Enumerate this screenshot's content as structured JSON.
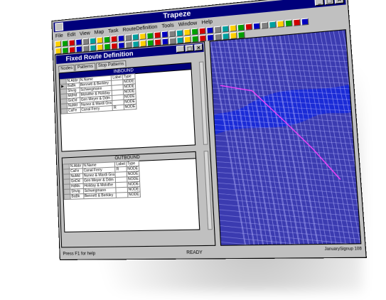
{
  "window": {
    "title": "Trapeze"
  },
  "menus": [
    "File",
    "Edit",
    "View",
    "Map",
    "Task",
    "RouteDefinition",
    "Tools",
    "Window",
    "Help"
  ],
  "child": {
    "title": "Fixed Route Definition",
    "tabs": [
      "Nodes",
      "Patterns",
      "Stop Patterns"
    ]
  },
  "inbound": {
    "header": "INBOUND",
    "columns": [
      "N.Abbr",
      "N.Name",
      "Label",
      "Type"
    ],
    "rows": [
      [
        "BaBk",
        "Bennett & Berkley",
        "",
        "NODE"
      ],
      [
        "Shvig",
        "Schwegmann",
        "",
        "NODE"
      ],
      [
        "MdHd",
        "Molvithe & Holiday",
        "",
        "NODE"
      ],
      [
        "GnDd",
        "Gen Meyer & Ddm",
        "",
        "NODE"
      ],
      [
        "NuMd",
        "Nunez & Mardi Gra",
        "",
        "NODE"
      ],
      [
        "CaFe",
        "Canal Ferry",
        "R",
        "NODE"
      ]
    ]
  },
  "outbound": {
    "header": "OUTBOUND",
    "columns": [
      "N.Abbr",
      "N.Name",
      "Label",
      "Type"
    ],
    "rows": [
      [
        "CaFe",
        "Canal Ferry",
        "R",
        "NODE"
      ],
      [
        "NuMd",
        "Nunez & Mardi Gra",
        "",
        "NODE"
      ],
      [
        "GnDd",
        "Gen Meyer & Ddm",
        "",
        "NODE"
      ],
      [
        "HdMc",
        "Holiday & Molvthe",
        "",
        "NODE"
      ],
      [
        "Shvig",
        "Schwegmann",
        "",
        "NODE"
      ],
      [
        "BaBk",
        "Bennett & Berkley",
        "",
        "NODE"
      ]
    ]
  },
  "map": {
    "water_color": "#1a2bd6",
    "street_color": "#b9b9ff"
  },
  "status": {
    "left": "Press F1 for help",
    "center": "READY",
    "right": "JanuarySignup 108"
  }
}
